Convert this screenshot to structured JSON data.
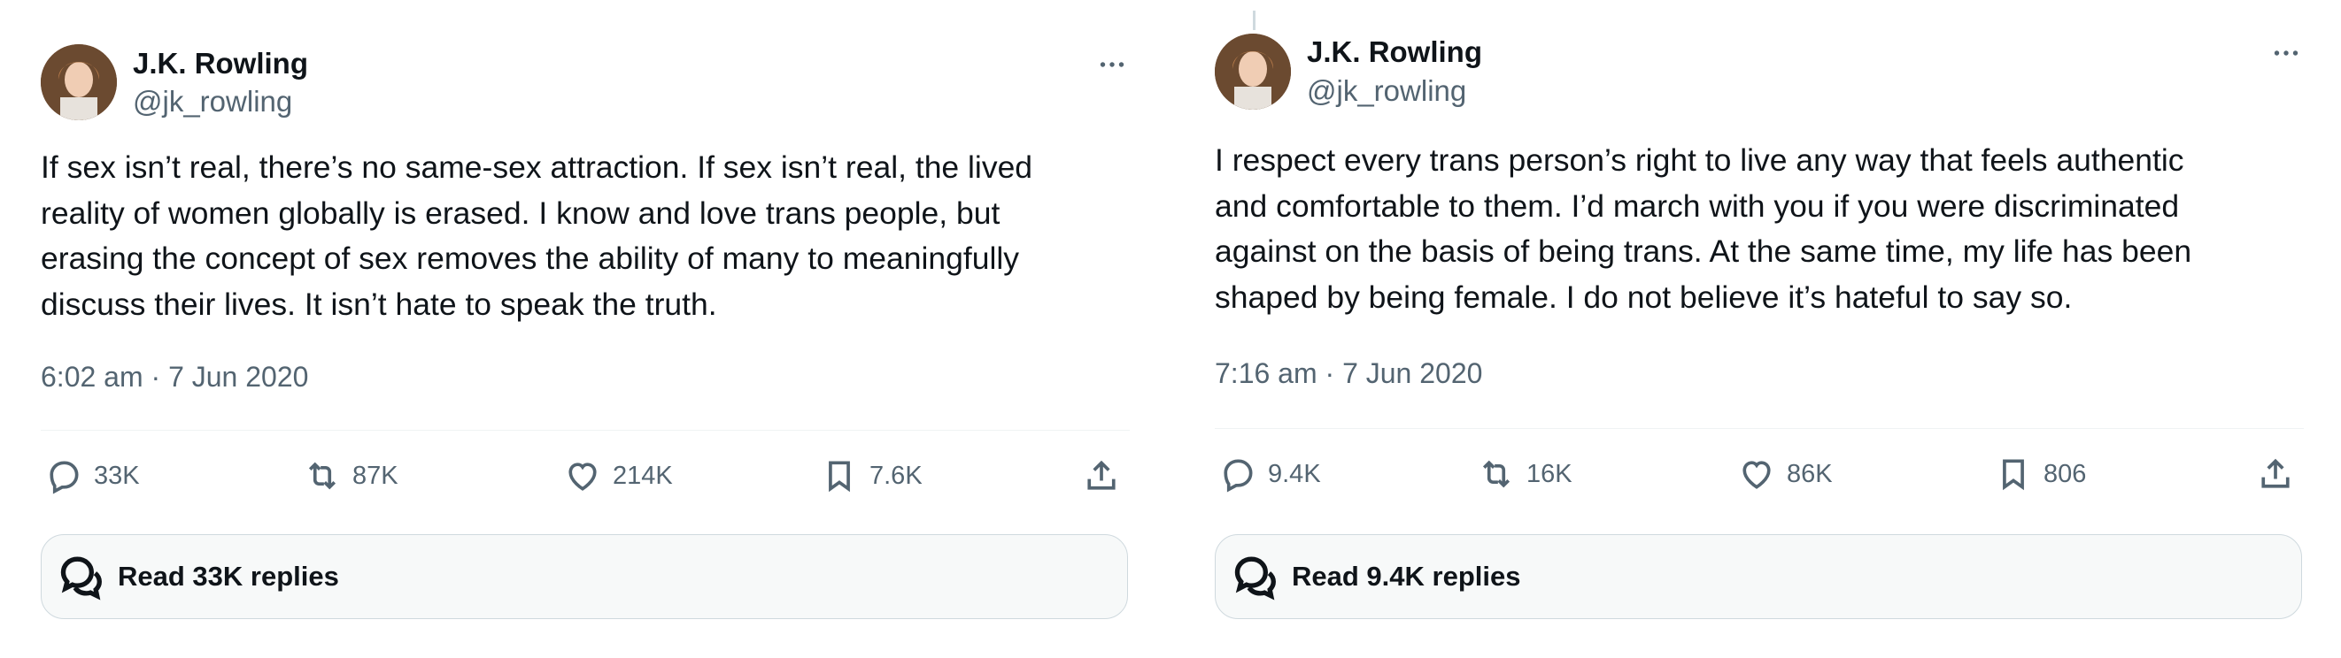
{
  "tweets": [
    {
      "author": {
        "name": "J.K. Rowling",
        "handle": "@jk_rowling"
      },
      "text_lines": [
        "If sex isn’t real, there’s no same-sex attraction. If sex isn’t real, the lived",
        "reality of women globally is erased. I know and love trans people, but",
        "erasing the concept of sex removes the ability of many to meaningfully",
        "discuss their lives. It isn’t hate to speak the truth."
      ],
      "timestamp": "6:02 am · 7 Jun 2020",
      "stats": {
        "replies": "33K",
        "reposts": "87K",
        "likes": "214K",
        "bookmarks": "7.6K"
      },
      "read_replies": "Read 33K replies",
      "icons": {
        "more": "more-dots-icon",
        "reply": "reply-icon",
        "repost": "repost-icon",
        "like": "heart-icon",
        "bookmark": "bookmark-icon",
        "share": "share-icon"
      }
    },
    {
      "author": {
        "name": "J.K. Rowling",
        "handle": "@jk_rowling"
      },
      "text_lines": [
        "I respect every trans person’s right to live any way that feels authentic",
        "and comfortable to them. I’d march with you if you were discriminated",
        "against on the basis of being trans. At the same time, my life has been",
        "shaped by being female. I do not believe it’s hateful to say so."
      ],
      "timestamp": "7:16 am · 7 Jun 2020",
      "stats": {
        "replies": "9.4K",
        "reposts": "16K",
        "likes": "86K",
        "bookmarks": "806"
      },
      "read_replies": "Read 9.4K replies",
      "icons": {
        "more": "more-dots-icon",
        "reply": "reply-icon",
        "repost": "repost-icon",
        "like": "heart-icon",
        "bookmark": "bookmark-icon",
        "share": "share-icon"
      }
    }
  ],
  "colors": {
    "text": "#0f1419",
    "secondary": "#536471",
    "border": "#cfd9de",
    "reply_bg": "#f7f9f9"
  }
}
